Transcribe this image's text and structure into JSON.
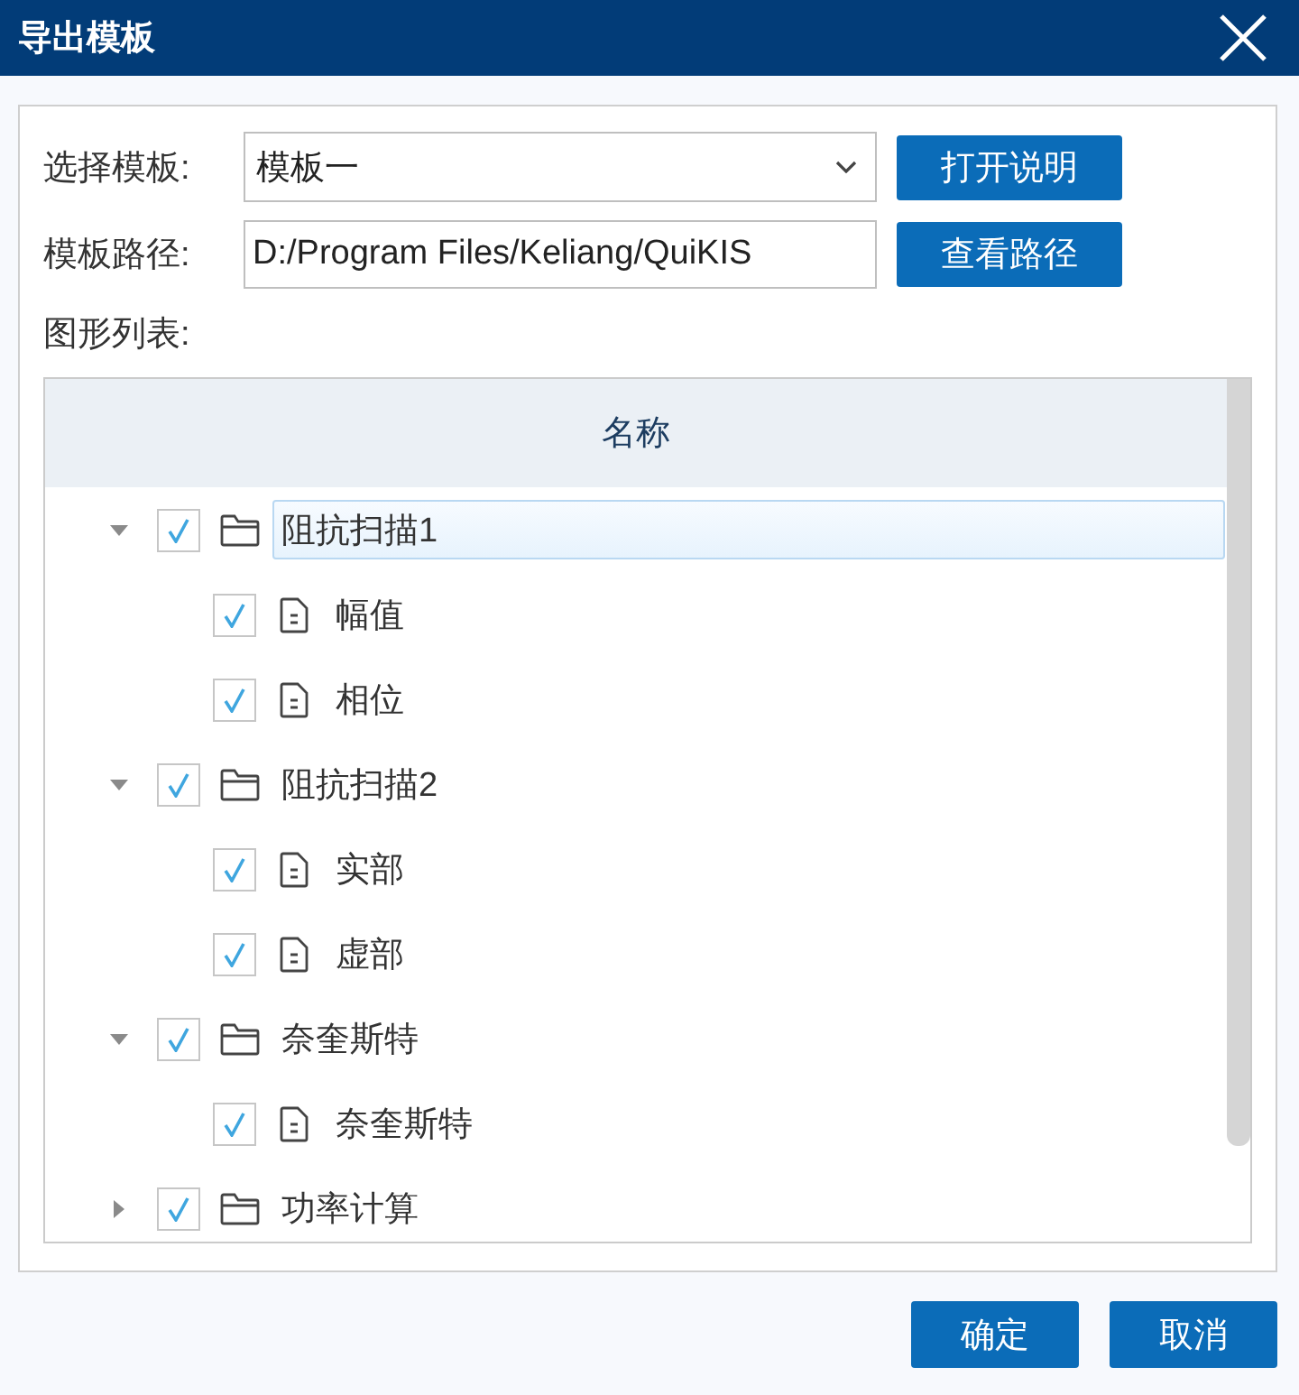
{
  "window": {
    "title": "导出模板"
  },
  "template": {
    "label": "选择模板:",
    "value": "模板一",
    "button": "打开说明"
  },
  "path": {
    "label": "模板路径:",
    "value": "D:/Program Files/Keliang/QuiKIS",
    "button": "查看路径"
  },
  "list": {
    "label": "图形列表:",
    "column": "名称",
    "items": [
      {
        "name": "阻抗扫描1",
        "kind": "folder",
        "checked": true,
        "expanded": true,
        "selected": true,
        "children": [
          {
            "name": "幅值",
            "kind": "file",
            "checked": true,
            "selected": false
          },
          {
            "name": "相位",
            "kind": "file",
            "checked": true,
            "selected": false
          }
        ]
      },
      {
        "name": "阻抗扫描2",
        "kind": "folder",
        "checked": true,
        "expanded": true,
        "selected": false,
        "children": [
          {
            "name": "实部",
            "kind": "file",
            "checked": true,
            "selected": false
          },
          {
            "name": "虚部",
            "kind": "file",
            "checked": true,
            "selected": false
          }
        ]
      },
      {
        "name": "奈奎斯特",
        "kind": "folder",
        "checked": true,
        "expanded": true,
        "selected": false,
        "children": [
          {
            "name": "奈奎斯特",
            "kind": "file",
            "checked": true,
            "selected": false
          }
        ]
      },
      {
        "name": "功率计算",
        "kind": "folder",
        "checked": true,
        "expanded": false,
        "selected": false
      }
    ]
  },
  "buttons": [
    {
      "label": "确定"
    },
    {
      "label": "取消"
    }
  ]
}
